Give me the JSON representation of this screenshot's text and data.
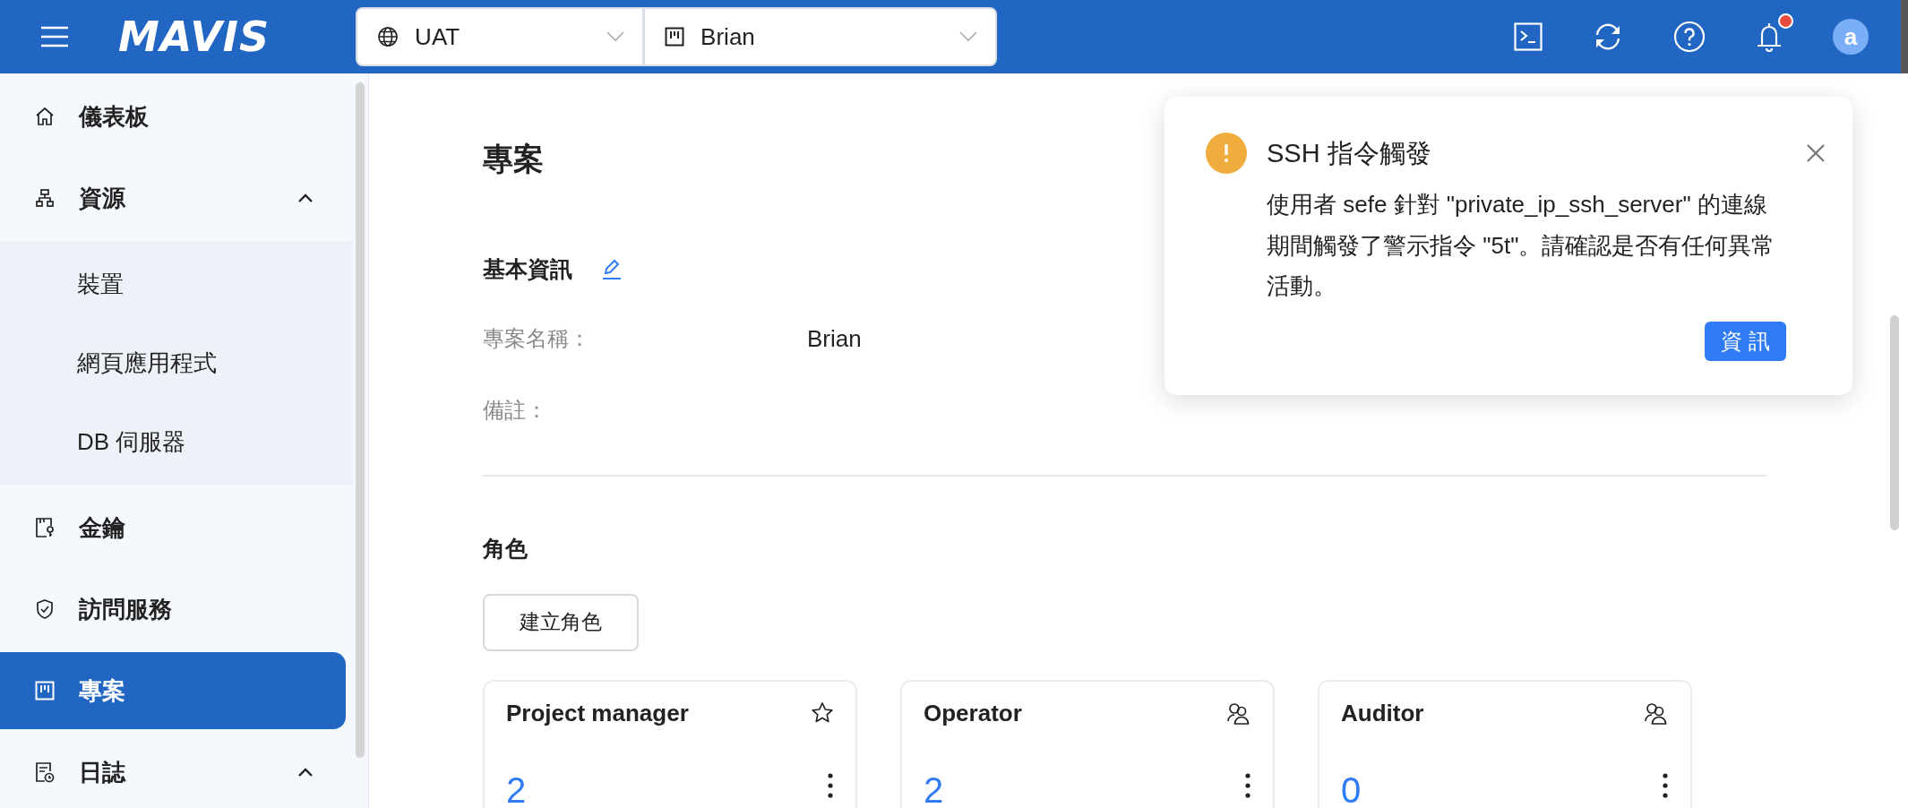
{
  "topbar": {
    "logo": "MAVIS",
    "environment": {
      "value": "UAT"
    },
    "project": {
      "value": "Brian"
    },
    "notifications_unread": true,
    "avatar": "a"
  },
  "sidebar": {
    "items": [
      {
        "label": "儀表板",
        "kind": "home",
        "selected": false
      },
      {
        "label": "資源",
        "kind": "resources",
        "selected": false,
        "expanded": true,
        "children": [
          {
            "label": "裝置",
            "selected": false
          },
          {
            "label": "網頁應用程式",
            "selected": false
          },
          {
            "label": "DB 伺服器",
            "selected": false
          }
        ]
      },
      {
        "label": "金鑰",
        "kind": "key",
        "selected": false
      },
      {
        "label": "訪問服務",
        "kind": "shield",
        "selected": false
      },
      {
        "label": "專案",
        "kind": "board",
        "selected": true
      },
      {
        "label": "日誌",
        "kind": "log",
        "selected": false,
        "expanded": true
      }
    ]
  },
  "page": {
    "title": "專案",
    "basic_info": {
      "heading": "基本資訊",
      "fields": [
        {
          "label": "專案名稱：",
          "value": "Brian"
        },
        {
          "label": "備註："
        }
      ]
    },
    "roles": {
      "heading": "角色",
      "create_button": "建立角色",
      "cards": [
        {
          "name": "Project manager",
          "kind": "star",
          "count": "2"
        },
        {
          "name": "Operator",
          "kind": "users",
          "count": "2"
        },
        {
          "name": "Auditor",
          "kind": "users",
          "count": "0"
        }
      ]
    }
  },
  "notification": {
    "kind": "warning",
    "title": "SSH 指令觸發",
    "message": "使用者 sefe 針對 \"private_ip_ssh_server\" 的連線期間觸發了警示指令 \"5t\"。請確認是否有任何異常活動。",
    "action": "資 訊"
  }
}
